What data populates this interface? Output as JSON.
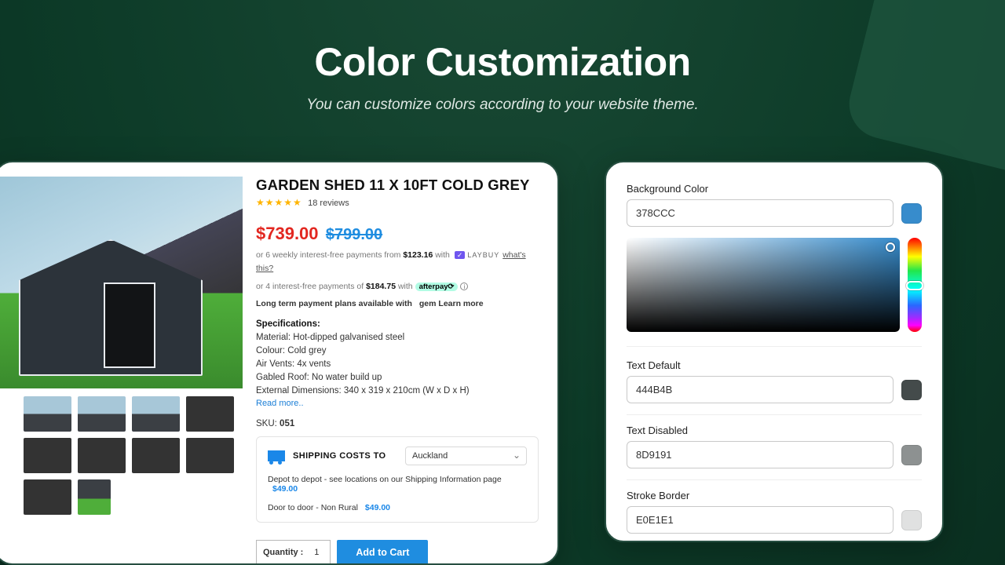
{
  "hero": {
    "title": "Color Customization",
    "subtitle": "You can customize colors according to your website theme."
  },
  "product": {
    "title": "GARDEN SHED 11 X 10FT COLD GREY",
    "reviews_count": "18 reviews",
    "price_now": "$739.00",
    "price_was": "$799.00",
    "finance1_pre": "or 6 weekly interest-free payments from ",
    "finance1_amount": "$123.16",
    "finance1_with": " with ",
    "laybuy_badge": "✓",
    "laybuy_text": "LAYBUY",
    "whats_this": "what's this?",
    "finance2_pre": "or 4 interest-free payments of ",
    "finance2_amount": "$184.75",
    "finance2_with": " with ",
    "afterpay": "afterpay⟳",
    "longterm": "Long term payment plans available with",
    "gem": "gem",
    "learn_more": "Learn more",
    "specs_heading": "Specifications:",
    "spec_material": "Material: Hot-dipped galvanised steel",
    "spec_colour": "Colour: Cold grey",
    "spec_vents": "Air Vents: 4x vents",
    "spec_roof": "Gabled Roof: No water build up",
    "spec_dims": "External Dimensions: 340 x 319 x 210cm (W x D x H)",
    "read_more": "Read more..",
    "sku_label": "SKU: ",
    "sku_value": "051",
    "shipping_title": "SHIPPING COSTS TO",
    "shipping_region": "Auckland",
    "ship_line1": "Depot to depot - see locations on our Shipping Information page",
    "ship_price1": "$49.00",
    "ship_line2": "Door to door - Non Rural",
    "ship_price2": "$49.00",
    "qty_label": "Quantity :",
    "qty_value": "1",
    "add_to_cart": "Add to Cart"
  },
  "panel": {
    "bg_label": "Background Color",
    "bg_value": "378CCC",
    "bg_swatch": "#378CCC",
    "text_default_label": "Text Default",
    "text_default_value": "444B4B",
    "text_default_swatch": "#444B4B",
    "text_disabled_label": "Text Disabled",
    "text_disabled_value": "8D9191",
    "text_disabled_swatch": "#8D9191",
    "stroke_label": "Stroke Border",
    "stroke_value": "E0E1E1",
    "stroke_swatch": "#E0E1E1"
  }
}
